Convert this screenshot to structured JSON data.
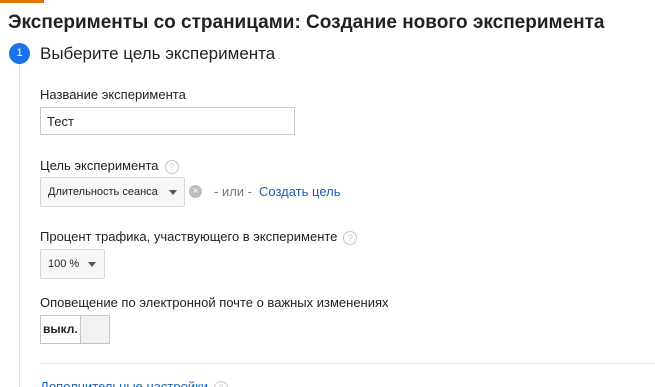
{
  "page_title": "Эксперименты со страницами: Создание нового эксперимента",
  "step": {
    "number": "1",
    "title": "Выберите цель эксперимента"
  },
  "experiment_name": {
    "label": "Название эксперимента",
    "value": "Тест"
  },
  "goal": {
    "label": "Цель эксперимента",
    "selected": "Длительность сеанса",
    "or_text": "- или -",
    "create_link": "Создать цель"
  },
  "traffic": {
    "label": "Процент трафика, участвующего в эксперименте",
    "selected": "100 %"
  },
  "email_notify": {
    "label": "Оповещение по электронной почте о важных изменениях",
    "toggle_label": "выкл."
  },
  "advanced": {
    "link_label": "Дополнительные настройки"
  },
  "icons": {
    "help": "?",
    "clear": "×"
  },
  "colors": {
    "accent": "#1a73e8",
    "link": "#1a5fb4",
    "top_bar": "#e37400"
  }
}
